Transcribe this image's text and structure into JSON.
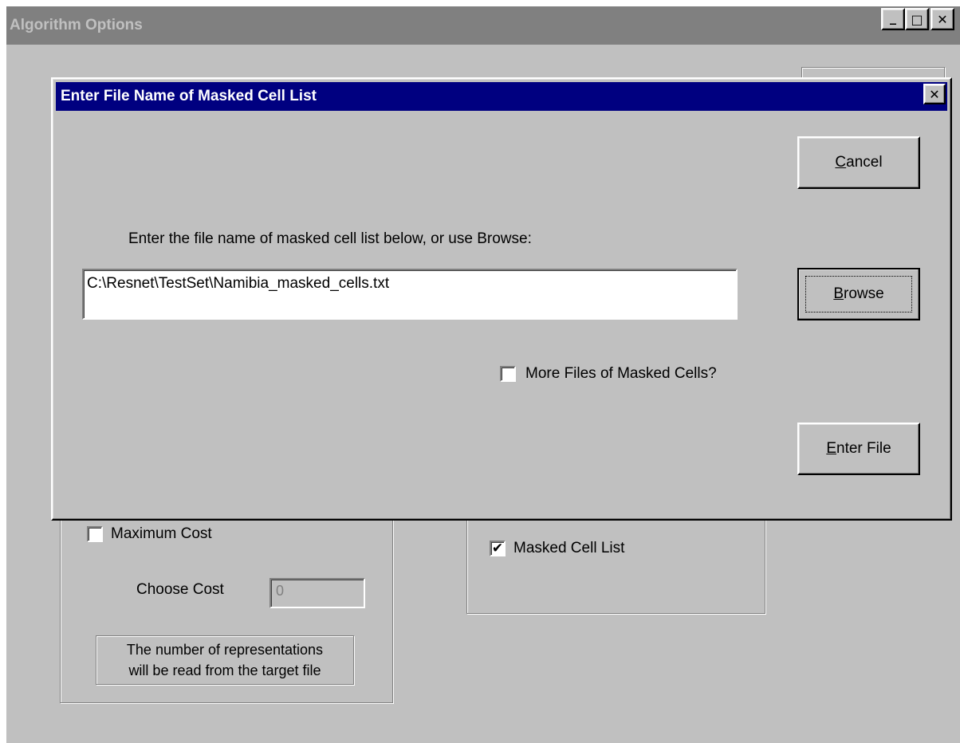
{
  "main_window": {
    "title": "Algorithm Options",
    "controls": {
      "minimize": "_",
      "maximize": "□",
      "close": "✕"
    },
    "maximum_cost_label": "Maximum Cost",
    "maximum_cost_checked": false,
    "choose_cost_label": "Choose Cost",
    "choose_cost_value": "0",
    "representations_note_line1": "The number of representations",
    "representations_note_line2": "will be read from the target file",
    "masked_cell_list_label": "Masked Cell List",
    "masked_cell_list_checked": true
  },
  "dialog": {
    "title": "Enter File Name of Masked Cell List",
    "close_glyph": "✕",
    "cancel_pre": "",
    "cancel_key": "C",
    "cancel_post": "ancel",
    "prompt": "Enter the file name of masked cell list below, or use Browse:",
    "file_value": "C:\\Resnet\\TestSet\\Namibia_masked_cells.txt",
    "browse_key": "B",
    "browse_post": "rowse",
    "more_files_label": "More Files of Masked Cells?",
    "more_files_checked": false,
    "enter_key": "E",
    "enter_post": "nter File"
  },
  "icons": {
    "check_glyph": "✔"
  }
}
